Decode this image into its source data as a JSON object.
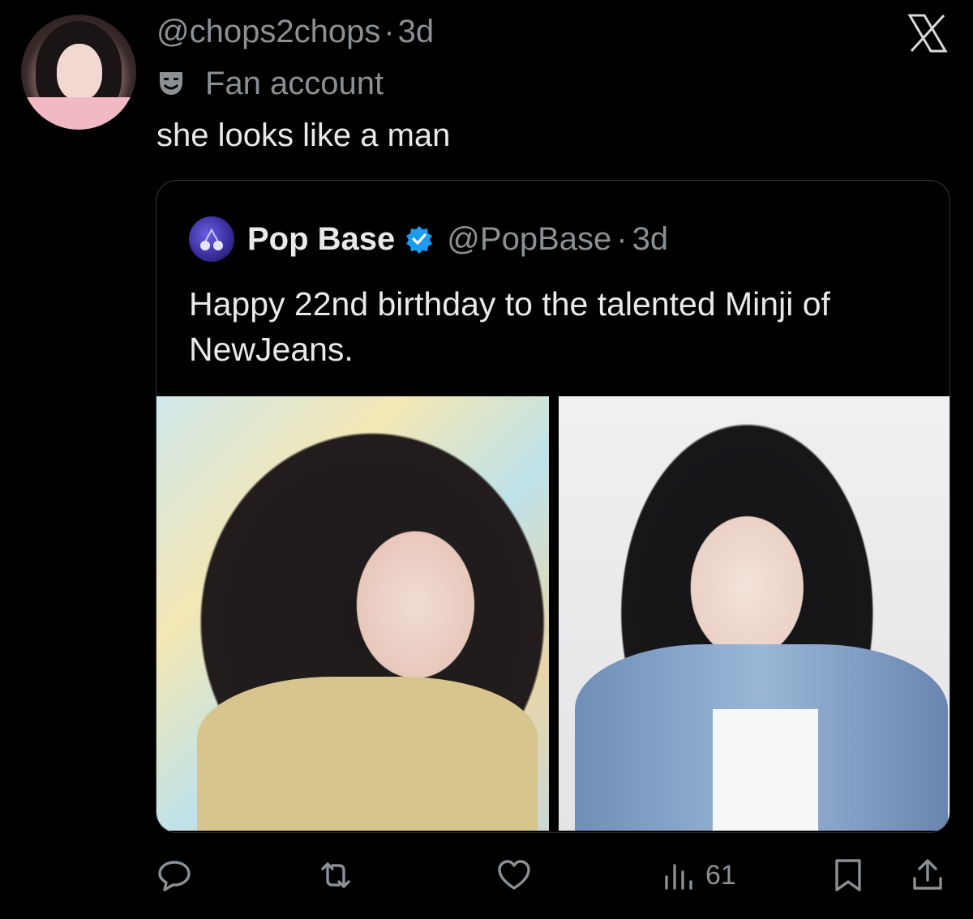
{
  "tweet": {
    "handle": "@chops2chops",
    "separator": "·",
    "time": "3d",
    "label": "Fan account",
    "text": "she looks like a man"
  },
  "quote": {
    "name": "Pop Base",
    "handle": "@PopBase",
    "separator": "·",
    "time": "3d",
    "text": "Happy 22nd birthday to the talented Minji of NewJeans."
  },
  "actions": {
    "views": "61"
  },
  "icons": {
    "close": "x-close-icon",
    "label": "fan-mask-icon",
    "verified": "verified-badge-icon",
    "reply": "reply-icon",
    "retweet": "retweet-icon",
    "like": "like-icon",
    "views": "views-icon",
    "bookmark": "bookmark-icon",
    "share": "share-icon"
  },
  "colors": {
    "background": "#000000",
    "text": "#e7e9ea",
    "secondary": "#8b9095",
    "verified": "#1d9bf0",
    "border": "#343a3f"
  }
}
